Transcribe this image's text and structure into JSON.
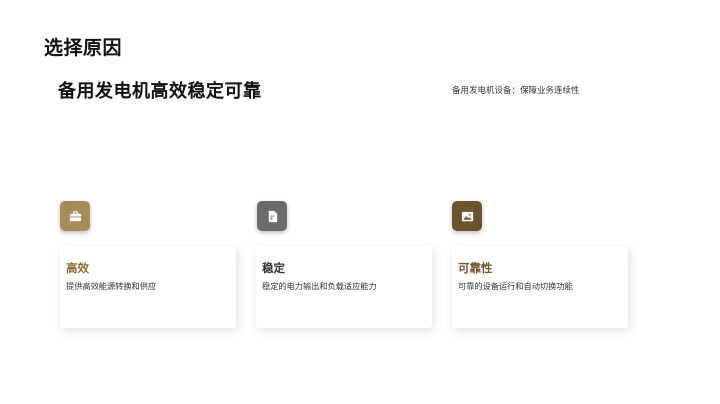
{
  "header": {
    "title": "选择原因"
  },
  "hero": {
    "headline": "备用发电机高效稳定可靠",
    "note": "备用发电机设备：保障业务连续性"
  },
  "features": [
    {
      "title": "高效",
      "description": "提供高效能源转换和供应",
      "icon": "briefcase-icon",
      "accent": "#a58c5b",
      "title_color": "#8a6d3b"
    },
    {
      "title": "稳定",
      "description": "稳定的电力输出和负载适应能力",
      "icon": "document-icon",
      "accent": "#6b6b6b",
      "title_color": "#333333"
    },
    {
      "title": "可靠性",
      "description": "可靠的设备运行和自动切换功能",
      "icon": "image-icon",
      "accent": "#6b5531",
      "title_color": "#6b5531"
    }
  ]
}
